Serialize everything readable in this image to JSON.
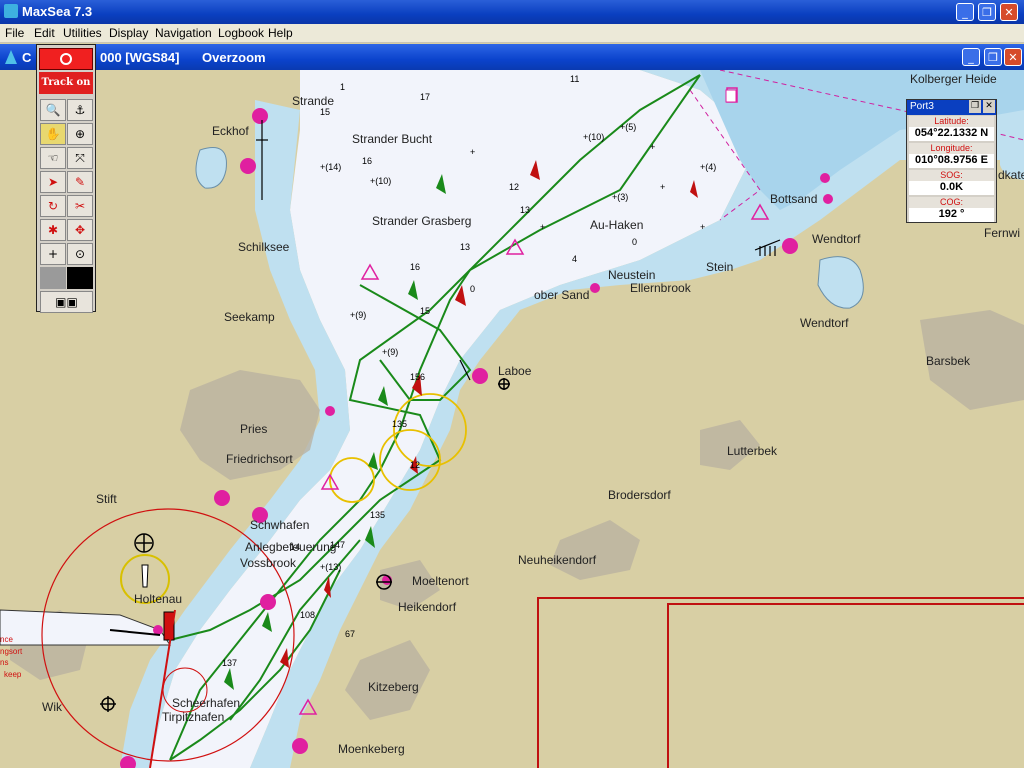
{
  "app": {
    "title": "MaxSea 7.3"
  },
  "menu": [
    "File",
    "Edit",
    "Utilities",
    "Display",
    "Navigation",
    "Logbook",
    "Help"
  ],
  "chart_window": {
    "title_prefix": "C",
    "title_suffix": "000 [WGS84]",
    "mode": "Overzoom"
  },
  "palette": {
    "track_label": "Track on"
  },
  "info": {
    "title": "Port3",
    "lat_label": "Latitude:",
    "lat_value": "054°22.1332 N",
    "lon_label": "Longitude:",
    "lon_value": "010°08.9756 E",
    "sog_label": "SOG:",
    "sog_value": "0.0K",
    "cog_label": "COG:",
    "cog_value": "192 °"
  },
  "places": {
    "strande": "Strande",
    "eckhof": "Eckhof",
    "strander_bucht": "Strander Bucht",
    "strander_grasberg": "Strander Grasberg",
    "schilksee": "Schilksee",
    "seekamp": "Seekamp",
    "au_haken": "Au-Haken",
    "neustein": "Neustein",
    "ellernbrook": "Ellernbrook",
    "stein": "Stein",
    "bottsand": "Bottsand",
    "wendtorf1": "Wendtorf",
    "wendtorf2": "Wendtorf",
    "fernwi": "Fernwi",
    "barsbek": "Barsbek",
    "kolberger": "Kolberger Heide",
    "dkate": "dkate",
    "laboe": "Laboe",
    "ober_sand": "ober Sand",
    "pries": "Pries",
    "friedrichsort": "Friedrichsort",
    "lutterbek": "Lutterbek",
    "brodersdorf": "Brodersdorf",
    "stift": "Stift",
    "schilksee2": "Schilksee",
    "neuheikendorf": "Neuheikendorf",
    "hotenau": "Holtenau",
    "moeltenort": "Moeltenort",
    "heikendorf": "Heikendorf",
    "kitzeberg": "Kitzeberg",
    "wik": "Wik",
    "scheerhafen": "Scheerhafen",
    "tirpitzhafen": "Tirpitzhafen",
    "moenkeberg": "Moenkeberg",
    "leuchtfeuer": "Anlegbefeuerung",
    "vossbrook": "Vossbrook",
    "schwhafen": "Schwhafen"
  }
}
